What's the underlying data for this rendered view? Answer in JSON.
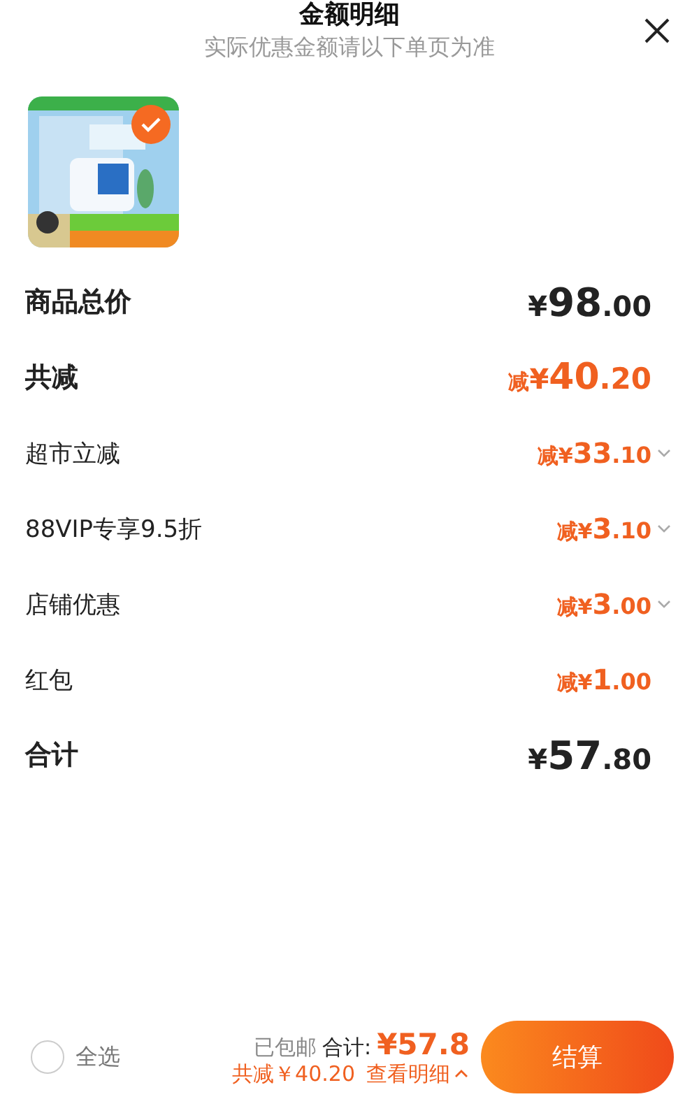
{
  "header": {
    "title": "金额明细",
    "subtitle": "实际优惠金额请以下单页为准"
  },
  "product": {
    "kind": "picture",
    "selected": true
  },
  "rows": [
    {
      "kind": "total",
      "label": "商品总价",
      "prefix": "",
      "currency": "¥",
      "integer": "98",
      "decimal": ".00",
      "expandable": false
    },
    {
      "kind": "saving",
      "label": "共减",
      "prefix": "减",
      "currency": "¥",
      "integer": "40",
      "decimal": ".20",
      "expandable": false
    },
    {
      "kind": "discount",
      "label": "超市立减",
      "prefix": "减",
      "currency": "¥",
      "integer": "33",
      "decimal": ".10",
      "expandable": true
    },
    {
      "kind": "discount",
      "label": "88VIP专享9.5折",
      "prefix": "减",
      "currency": "¥",
      "integer": "3",
      "decimal": ".10",
      "expandable": true
    },
    {
      "kind": "discount",
      "label": "店铺优惠",
      "prefix": "减",
      "currency": "¥",
      "integer": "3",
      "decimal": ".00",
      "expandable": true
    },
    {
      "kind": "discount",
      "label": "红包",
      "prefix": "减",
      "currency": "¥",
      "integer": "1",
      "decimal": ".00",
      "expandable": false
    },
    {
      "kind": "total",
      "label": "合计",
      "prefix": "",
      "currency": "¥",
      "integer": "57",
      "decimal": ".80",
      "expandable": false
    }
  ],
  "footer": {
    "select_all": {
      "label": "全选",
      "selected": false
    },
    "shipping": "已包邮",
    "total_label": "合计:",
    "total": "¥57.8",
    "saving": "共减￥40.20",
    "details_link": "查看明细",
    "details_expanded": true,
    "checkout": "结算"
  }
}
